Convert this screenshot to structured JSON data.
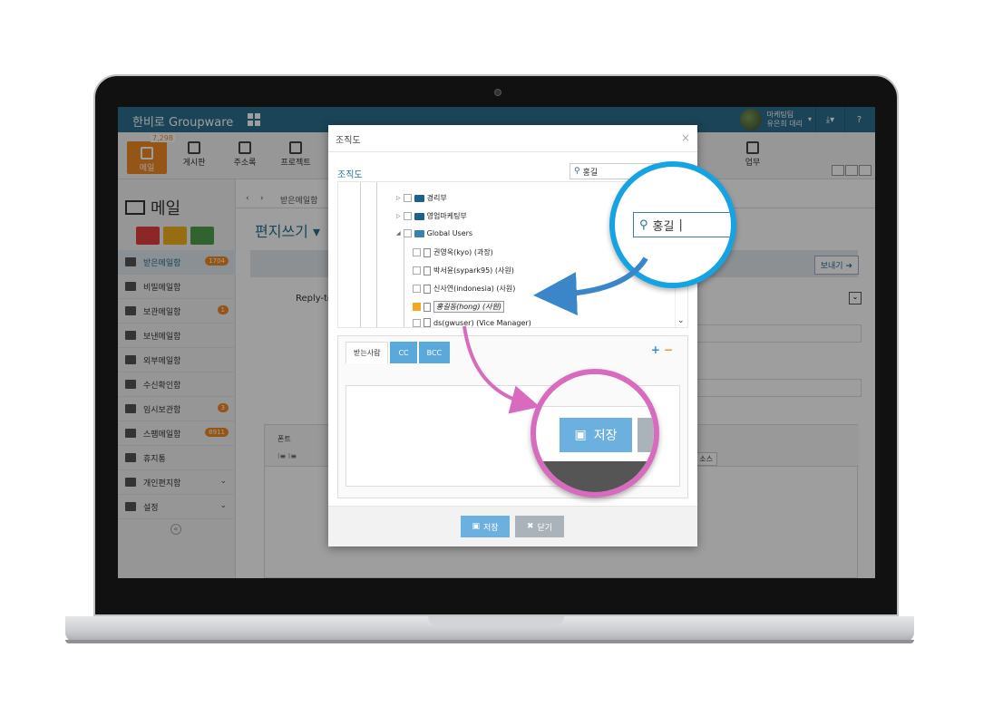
{
  "app": {
    "title": "한비로 Groupware"
  },
  "user": {
    "dept": "마케팅팀",
    "name": "유은희 대리"
  },
  "toolbar": {
    "items": [
      {
        "label": "메일",
        "count": "7,298"
      },
      {
        "label": "게시판"
      },
      {
        "label": "주소록"
      },
      {
        "label": "프로젝트"
      },
      {
        "label": "업무"
      }
    ]
  },
  "sidebar": {
    "title": "메일",
    "items": [
      {
        "label": "받은메일함",
        "count": "1704"
      },
      {
        "label": "비밀메일함"
      },
      {
        "label": "보관메일함",
        "count": "1"
      },
      {
        "label": "보낸메일함"
      },
      {
        "label": "외부메일함"
      },
      {
        "label": "수신확인함"
      },
      {
        "label": "임시보관함",
        "count": "3"
      },
      {
        "label": "스팸메일함",
        "count": "6911"
      },
      {
        "label": "휴지통"
      },
      {
        "label": "개인편지함"
      },
      {
        "label": "설정"
      }
    ]
  },
  "main": {
    "crumb": "받은메일함",
    "title": "편지쓰기",
    "send_label": "보내기",
    "reply_label": "Reply-to",
    "editor_font": "폰트",
    "source_label": "소스"
  },
  "dialog": {
    "title": "조직도",
    "org_label": "조직도",
    "search_value": "홍길",
    "tree": [
      {
        "label": "경리부",
        "type": "folder"
      },
      {
        "label": "영업마케팅부",
        "type": "folder"
      },
      {
        "label": "Global Users",
        "type": "folder-open"
      },
      {
        "label": "권영옥(kyo) (과장)",
        "type": "user"
      },
      {
        "label": "박서윤(sypark95) (사원)",
        "type": "user"
      },
      {
        "label": "신사연(indonesia) (사원)",
        "type": "user"
      },
      {
        "label": "홍길동(hong) (사원)",
        "type": "user",
        "checked": true
      },
      {
        "label": "ds(gwuser) (Vice Manager)",
        "type": "user"
      }
    ],
    "tabs": [
      "받는사람",
      "CC",
      "BCC"
    ],
    "save_label": "저장",
    "close_label": "닫기"
  },
  "zoom": {
    "search_value": "홍길",
    "save_label": "저장"
  },
  "colors": {
    "header": "#2d6f8e",
    "accent": "#f08a24",
    "save": "#6cb0e0",
    "blue_ring": "#16a3e2",
    "pink_ring": "#d96bbf"
  }
}
